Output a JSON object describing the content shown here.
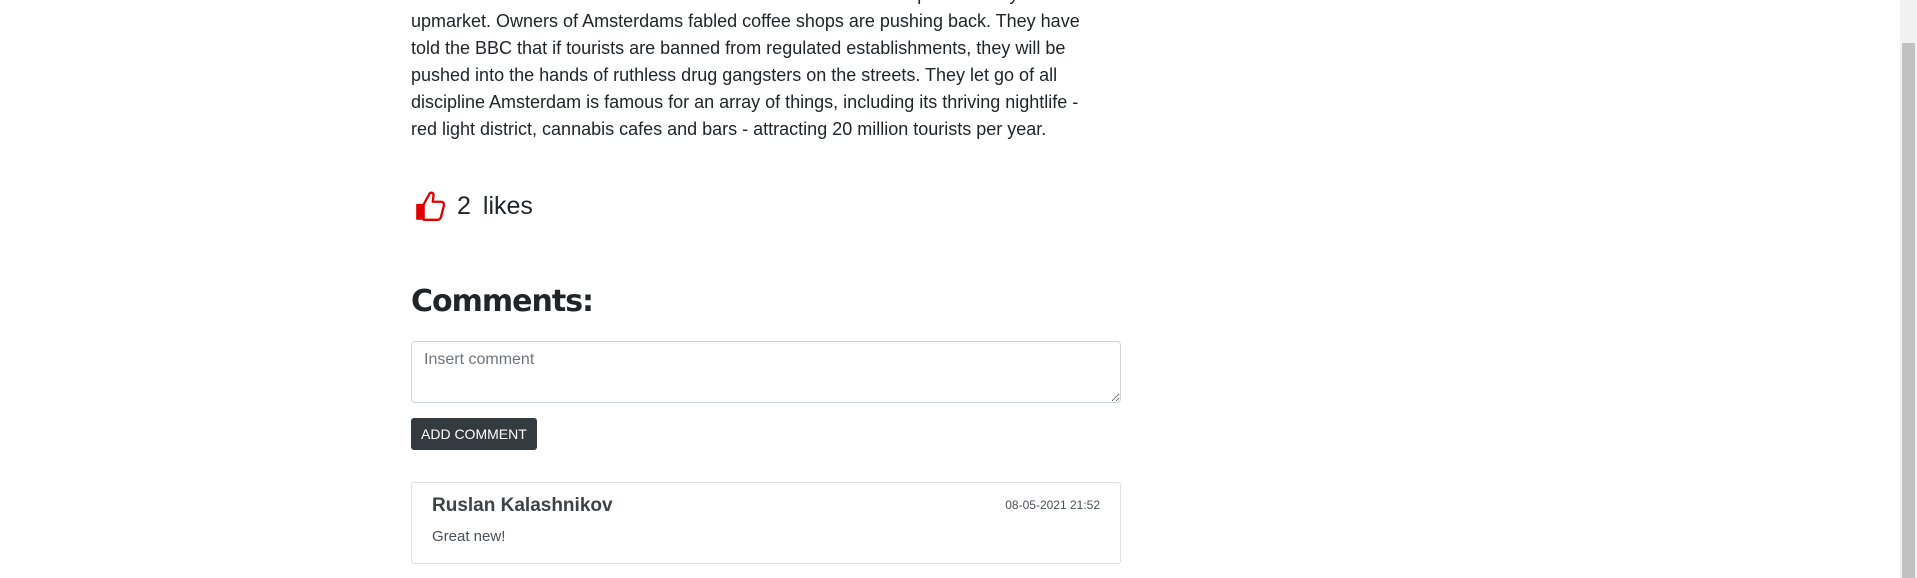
{
  "article": {
    "lines": [
      "tourists from cannabis cafes to tackle anti-social behaviour and push the city",
      "upmarket. Owners of Amsterdams fabled coffee shops are pushing back. They have",
      "told the BBC that if tourists are banned from regulated establishments, they will be",
      "pushed into the hands of ruthless drug gangsters on the streets. They let go of all",
      "discipline Amsterdam is famous for an array of things, including its thriving nightlife -",
      "red light district, cannabis cafes and bars - attracting 20 million tourists per year."
    ]
  },
  "likes": {
    "count": "2",
    "label": "likes",
    "icon": "thumbs-up-icon",
    "icon_color": "#e00000"
  },
  "comments": {
    "title": "Comments:",
    "input_placeholder": "Insert comment",
    "input_value": "",
    "add_button_label": "ADD COMMENT",
    "items": [
      {
        "author": "Ruslan Kalashnikov",
        "date": "08-05-2021 21:52",
        "text": "Great new!"
      }
    ]
  },
  "colors": {
    "button_bg": "#343a40",
    "text": "#212529"
  }
}
